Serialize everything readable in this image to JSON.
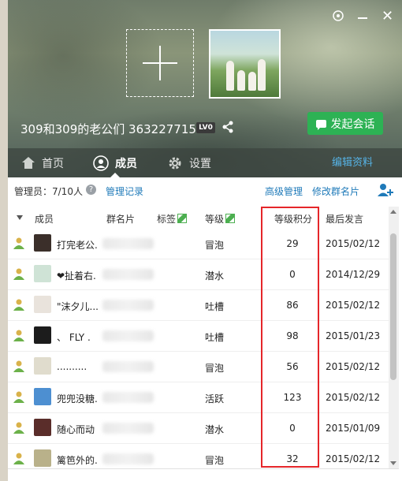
{
  "header": {
    "group_name": "309和309的老公们 363227715",
    "level_badge": "LV0",
    "chat_button": "发起会话",
    "edit_profile": "编辑资料"
  },
  "tabs": [
    {
      "label": "首页",
      "icon": "home-icon"
    },
    {
      "label": "成员",
      "icon": "member-icon",
      "active": true
    },
    {
      "label": "设置",
      "icon": "gear-icon"
    }
  ],
  "toolbar": {
    "admin_count": "管理员：7/10人",
    "manage_record": "管理记录",
    "advanced_manage": "高级管理",
    "modify_card": "修改群名片"
  },
  "table": {
    "columns": [
      "成员",
      "群名片",
      "标签",
      "等级",
      "等级积分",
      "最后发言"
    ],
    "rows": [
      {
        "nickname": "打完老公.",
        "level": "冒泡",
        "points": "29",
        "last": "2015/02/12"
      },
      {
        "nickname": "❤扯着右.",
        "level": "潜水",
        "points": "0",
        "last": "2014/12/29"
      },
      {
        "nickname": "\"沫夕儿...",
        "level": "吐槽",
        "points": "86",
        "last": "2015/02/12"
      },
      {
        "nickname": "、 FLY .",
        "level": "吐槽",
        "points": "98",
        "last": "2015/01/23"
      },
      {
        "nickname": "..........",
        "level": "冒泡",
        "points": "56",
        "last": "2015/02/12"
      },
      {
        "nickname": "兜兜没糖.",
        "level": "活跃",
        "points": "123",
        "last": "2015/02/12"
      },
      {
        "nickname": "随心而动",
        "level": "潜水",
        "points": "0",
        "last": "2015/01/09"
      },
      {
        "nickname": "篱笆外的.",
        "level": "冒泡",
        "points": "32",
        "last": "2015/02/12"
      }
    ]
  },
  "colors": {
    "accent_green": "#2db254",
    "link_blue": "#1f7ab9",
    "highlight_red": "#e5262a"
  }
}
